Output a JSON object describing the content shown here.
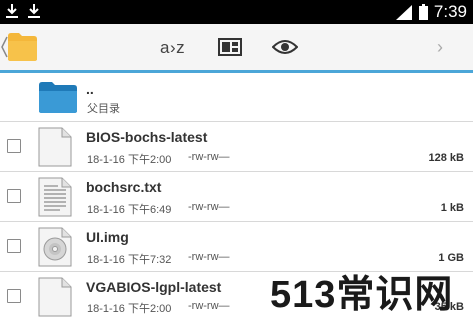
{
  "status_bar": {
    "time": "7:39",
    "left_icons": [
      "download-icon",
      "download-icon"
    ],
    "right_icons": [
      "signal-icon",
      "battery-icon"
    ]
  },
  "toolbar": {
    "sort_label": "a›z",
    "icons": [
      "back-chevron-icon",
      "folder-icon",
      "view-mode-icon",
      "eye-icon",
      "next-chevron-icon"
    ],
    "next_label": "›"
  },
  "parent_dir": {
    "name": "..",
    "label": "父目录"
  },
  "files": [
    {
      "name": "BIOS-bochs-latest",
      "date": "18-1-16 下午2:00",
      "perm": "-rw-rw—",
      "size": "128 kB",
      "icon": "blank-file-icon"
    },
    {
      "name": "bochsrc.txt",
      "date": "18-1-16 下午6:49",
      "perm": "-rw-rw—",
      "size": "1 kB",
      "icon": "text-file-icon"
    },
    {
      "name": "UI.img",
      "date": "18-1-16 下午7:32",
      "perm": "-rw-rw—",
      "size": "1 GB",
      "icon": "disc-image-icon"
    },
    {
      "name": "VGABIOS-lgpl-latest",
      "date": "18-1-16 下午2:00",
      "perm": "-rw-rw—",
      "size": "35 kB",
      "icon": "blank-file-icon"
    }
  ],
  "watermark": "513常识网",
  "colors": {
    "accent": "#4ba6d8",
    "folder_blue": "#2f8fc8",
    "folder_yellow": "#f4b73a"
  }
}
